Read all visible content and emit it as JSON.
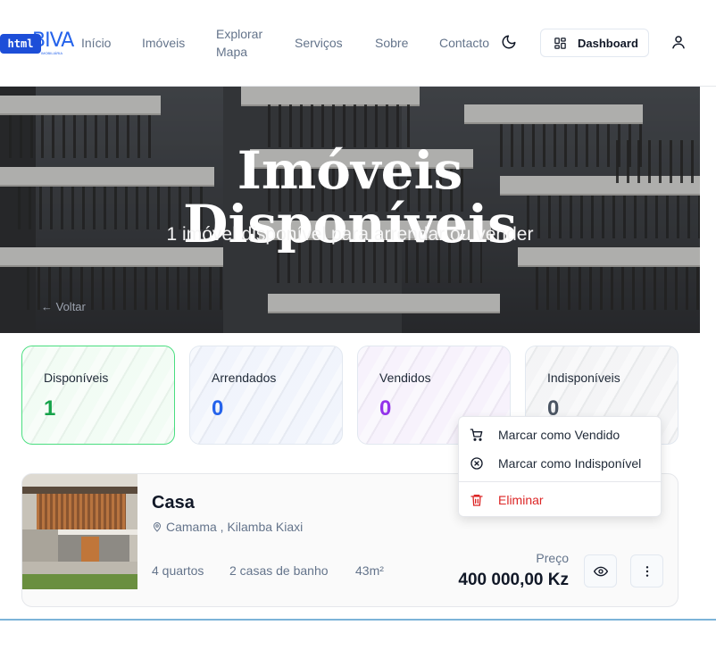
{
  "header": {
    "badge": "html",
    "logo_text": "BIVA",
    "logo_sub": "IMOBILIÁRIA",
    "nav": [
      {
        "label": "Início"
      },
      {
        "label": "Imóveis"
      },
      {
        "label_line1": "Explorar",
        "label_line2": "Mapa"
      },
      {
        "label": "Serviços"
      },
      {
        "label": "Sobre"
      },
      {
        "label": "Contacto"
      }
    ],
    "theme_icon": "moon-icon",
    "dashboard_label": "Dashboard",
    "user_icon": "user-icon"
  },
  "hero": {
    "title_line1": "Imóveis",
    "title_line2": "Disponíveis",
    "subtitle": "1 imóvel disponível para arrendar ou vender",
    "back_label": "Voltar"
  },
  "stats": [
    {
      "label": "Disponíveis",
      "value": "1",
      "color": "#16a34a",
      "bg": "#effbf2",
      "border": "#4ade80"
    },
    {
      "label": "Arrendados",
      "value": "0",
      "color": "#2563eb",
      "bg": "#eef2fb",
      "border": "#e2e8f0"
    },
    {
      "label": "Vendidos",
      "value": "0",
      "color": "#9333ea",
      "bg": "#f5effb",
      "border": "#e2e8f0"
    },
    {
      "label": "Indisponíveis",
      "value": "0",
      "color": "#4b5563",
      "bg": "#f1f2f4",
      "border": "#e2e8f0"
    }
  ],
  "menu": {
    "items": [
      {
        "label": "Marcar como Vendido",
        "icon": "cart-icon"
      },
      {
        "label": "Marcar como Indisponível",
        "icon": "x-circle-icon"
      },
      {
        "label": "Eliminar",
        "icon": "trash-icon",
        "color": "#dc2626"
      }
    ]
  },
  "property": {
    "title": "Casa",
    "location": "Camama , Kilamba Kiaxi",
    "bedrooms": "4 quartos",
    "bathrooms": "2 casas de banho",
    "area": "43m²",
    "price_label": "Preço",
    "price": "400 000,00 Kz"
  }
}
